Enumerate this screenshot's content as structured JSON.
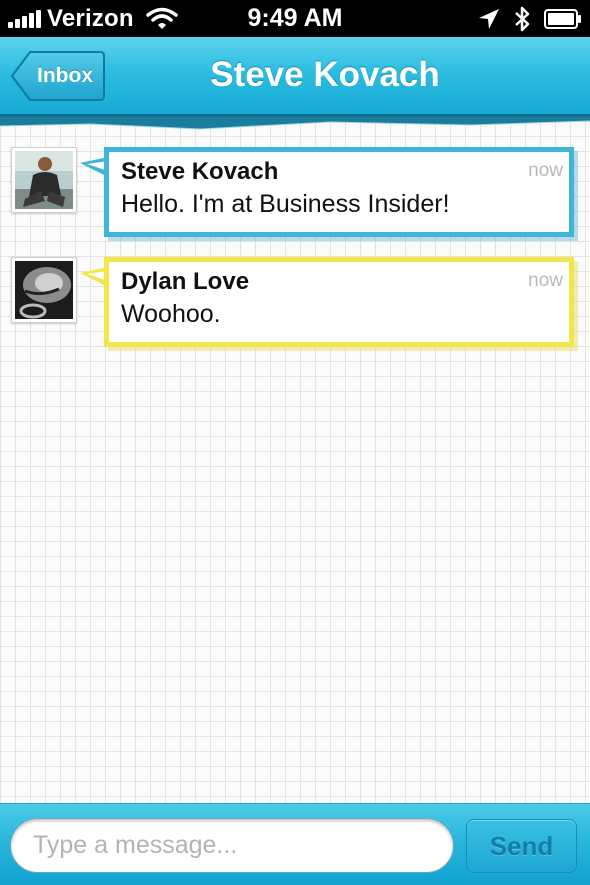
{
  "status_bar": {
    "carrier": "Verizon",
    "time": "9:49 AM",
    "icons": [
      "signal-bars-icon",
      "wifi-icon",
      "location-arrow-icon",
      "bluetooth-icon",
      "battery-icon"
    ]
  },
  "nav": {
    "back_label": "Inbox",
    "title": "Steve Kovach",
    "accent_color": "#2cbde0"
  },
  "messages": [
    {
      "sender": "Steve Kovach",
      "time": "now",
      "text": "Hello. I'm at Business Insider!",
      "bubble_color": "#3fb6d8"
    },
    {
      "sender": "Dylan Love",
      "time": "now",
      "text": "Woohoo.",
      "bubble_color": "#f2e64a"
    }
  ],
  "compose": {
    "placeholder": "Type a message...",
    "value": "",
    "send_label": "Send"
  }
}
